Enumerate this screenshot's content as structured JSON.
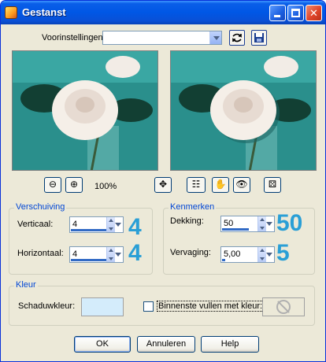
{
  "window": {
    "title": "Gestanst"
  },
  "presets": {
    "label": "Voorinstellingen:",
    "value": ""
  },
  "zoom": {
    "level": "100%"
  },
  "offset": {
    "title": "Verschuiving",
    "vertical": {
      "label": "Verticaal:",
      "value": "4",
      "annotation": "4"
    },
    "horizontal": {
      "label": "Horizontaal:",
      "value": "4",
      "annotation": "4"
    }
  },
  "attributes": {
    "title": "Kenmerken",
    "opacity": {
      "label": "Dekking:",
      "value": "50",
      "annotation": "50"
    },
    "blur": {
      "label": "Vervaging:",
      "value": "5,00",
      "annotation": "5"
    }
  },
  "color": {
    "title": "Kleur",
    "shadow_label": "Schaduwkleur:",
    "shadow_color": "#d4ecfb",
    "fill_inner_label": "Binnenste vullen met kleur:",
    "fill_inner_checked": false
  },
  "buttons": {
    "ok": "OK",
    "cancel": "Annuleren",
    "help": "Help"
  },
  "colors": {
    "accent": "#0046d5",
    "annotation": "#2a9fd6",
    "teal_bg": "#2a8f8c"
  }
}
